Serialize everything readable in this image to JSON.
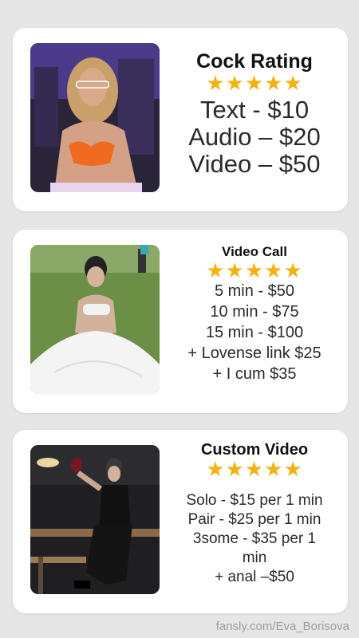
{
  "cards": [
    {
      "title": "Cock Rating",
      "stars": "★★★★★",
      "lines": [
        "Text - $10",
        "Audio – $20",
        "Video – $50"
      ]
    },
    {
      "title": "Video Call",
      "stars": "★★★★★",
      "lines": [
        "5 min - $50",
        "10 min - $75",
        "15 min - $100",
        "+ Lovense link  $25",
        "+ I cum $35"
      ]
    },
    {
      "title": "Custom Video",
      "stars": "★★★★★",
      "lines": [
        "Solo - $15 per 1 min",
        "Pair - $25 per 1 min",
        "3some - $35 per 1",
        "min",
        "+ anal –$50"
      ]
    }
  ],
  "watermark": "fansly.com/Eva_Borisova",
  "colors": {
    "background": "#e6e6e6",
    "card": "#ffffff",
    "star": "#f3b212"
  }
}
